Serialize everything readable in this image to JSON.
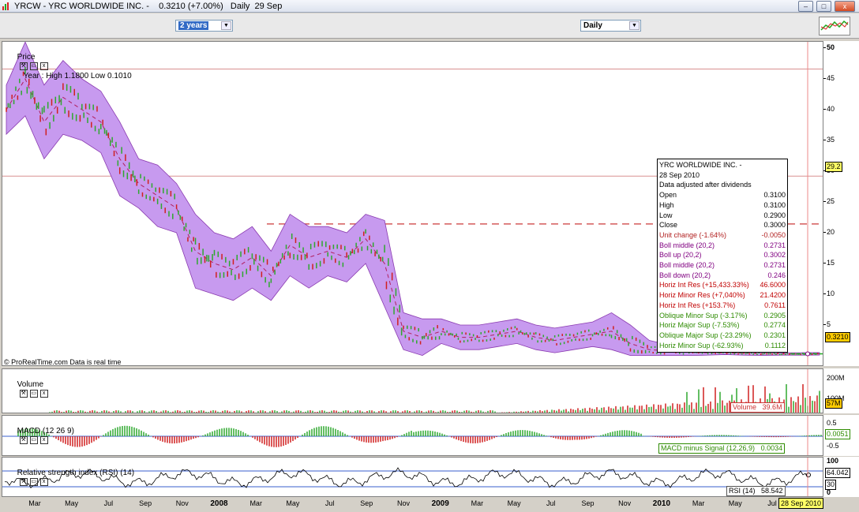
{
  "window": {
    "title": "YRCW - YRC WORLDWIDE INC. -    0.3210 (+7.00%)   Daily  29 Sep",
    "minimize": "–",
    "maximize": "□",
    "close": "x"
  },
  "toolbar": {
    "period": "2 years",
    "interval": "Daily"
  },
  "price_panel": {
    "title": "Price",
    "summary": "Year : High 1.1800 Low 0.1010",
    "footer": "© ProRealTime.com  Data is real time",
    "last_tag": "0.3210",
    "cursor_tag": "29.2"
  },
  "infobox": {
    "header": [
      "YRC WORLDWIDE INC. -",
      "28 Sep 2010",
      "Data adjusted after dividends"
    ],
    "rows": [
      {
        "label": "Open",
        "value": "0.3100",
        "color": "#000000"
      },
      {
        "label": "High",
        "value": "0.3100",
        "color": "#000000"
      },
      {
        "label": "Low",
        "value": "0.2900",
        "color": "#000000"
      },
      {
        "label": "Close",
        "value": "0.3000",
        "color": "#000000"
      },
      {
        "label": "Unit change (-1.64%)",
        "value": "-0.0050",
        "color": "#b22222"
      },
      {
        "label": "Boll middle (20,2)",
        "value": "0.2731",
        "color": "#800080"
      },
      {
        "label": "Boll up (20,2)",
        "value": "0.3002",
        "color": "#800080"
      },
      {
        "label": "Boll middle (20,2)",
        "value": "0.2731",
        "color": "#800080"
      },
      {
        "label": "Boll down (20,2)",
        "value": "0.246",
        "color": "#800080"
      },
      {
        "label": "Horiz Int Res (+15,433.33%)",
        "value": "46.6000",
        "color": "#c00000"
      },
      {
        "label": "Horiz Minor Res (+7,040%)",
        "value": "21.4200",
        "color": "#c00000"
      },
      {
        "label": "Horiz Int Res (+153.7%)",
        "value": "0.7611",
        "color": "#c00000"
      },
      {
        "label": "Oblique Minor Sup (-3.17%)",
        "value": "0.2905",
        "color": "#2e8b00"
      },
      {
        "label": "Horiz Major Sup (-7.53%)",
        "value": "0.2774",
        "color": "#2e8b00"
      },
      {
        "label": "Oblique Major Sup (-23.29%)",
        "value": "0.2301",
        "color": "#2e8b00"
      },
      {
        "label": "Horiz Minor Sup (-62.93%)",
        "value": "0.1112",
        "color": "#2e8b00"
      }
    ]
  },
  "volume_panel": {
    "title": "Volume",
    "readout_label": "Volume",
    "readout_value": "39.6M",
    "last_tag": "57M"
  },
  "macd_panel": {
    "title": "MACD (12 26 9)",
    "readout": "MACD minus Signal (12,26,9)",
    "readout_value": "0.0034",
    "last_tag": "0.0051"
  },
  "rsi_panel": {
    "title": "Relative strength index (RSI) (14)",
    "readout": "RSI (14)",
    "readout_value": "58.542",
    "last_tag": "64.042",
    "level_tag": "30"
  },
  "x_axis": {
    "labels": [
      {
        "t": "Mar",
        "yr": false
      },
      {
        "t": "May",
        "yr": false
      },
      {
        "t": "Jul",
        "yr": false
      },
      {
        "t": "Sep",
        "yr": false
      },
      {
        "t": "Nov",
        "yr": false
      },
      {
        "t": "2008",
        "yr": true
      },
      {
        "t": "Mar",
        "yr": false
      },
      {
        "t": "May",
        "yr": false
      },
      {
        "t": "Jul",
        "yr": false
      },
      {
        "t": "Sep",
        "yr": false
      },
      {
        "t": "Nov",
        "yr": false
      },
      {
        "t": "2009",
        "yr": true
      },
      {
        "t": "Mar",
        "yr": false
      },
      {
        "t": "May",
        "yr": false
      },
      {
        "t": "Jul",
        "yr": false
      },
      {
        "t": "Sep",
        "yr": false
      },
      {
        "t": "Nov",
        "yr": false
      },
      {
        "t": "2010",
        "yr": true
      },
      {
        "t": "Mar",
        "yr": false
      },
      {
        "t": "May",
        "yr": false
      },
      {
        "t": "Jul",
        "yr": false
      }
    ],
    "cursor": "28 Sep 2010"
  },
  "chart_data": {
    "type": "line",
    "title": "Price",
    "x": [
      "2007-02",
      "2007-03",
      "2007-04",
      "2007-05",
      "2007-06",
      "2007-07",
      "2007-08",
      "2007-09",
      "2007-10",
      "2007-11",
      "2007-12",
      "2008-01",
      "2008-02",
      "2008-03",
      "2008-04",
      "2008-05",
      "2008-06",
      "2008-07",
      "2008-08",
      "2008-09",
      "2008-10",
      "2008-11",
      "2008-12",
      "2009-01",
      "2009-02",
      "2009-03",
      "2009-04",
      "2009-05",
      "2009-06",
      "2009-07",
      "2009-08",
      "2009-09",
      "2009-10",
      "2009-11",
      "2009-12",
      "2010-01",
      "2010-02",
      "2010-03",
      "2010-04",
      "2010-05",
      "2010-06",
      "2010-07",
      "2010-08",
      "2010-09"
    ],
    "series": [
      {
        "name": "Price",
        "values": [
          40,
          45,
          38,
          42,
          40,
          38,
          32,
          28,
          26,
          24,
          17,
          15,
          14,
          16,
          13,
          18,
          16,
          17,
          16,
          19,
          15,
          4,
          3,
          4,
          3,
          3,
          3.5,
          4,
          3,
          2.5,
          3,
          3.5,
          4,
          2,
          1,
          0.8,
          0.6,
          0.5,
          0.5,
          0.4,
          0.35,
          0.3,
          0.3,
          0.32
        ]
      }
    ],
    "boll_width": [
      4,
      6,
      6,
      6,
      5,
      5,
      6,
      4,
      5,
      4,
      6,
      5,
      5,
      5,
      4,
      5,
      5,
      4,
      4,
      4,
      7,
      3,
      3,
      2,
      2,
      2,
      2,
      2,
      2,
      2,
      2,
      2,
      3,
      3,
      1.5,
      1,
      0.6,
      0.4,
      0.3,
      0.3,
      0.3,
      0.2,
      0.2,
      0.2
    ],
    "ylim": [
      0,
      50
    ],
    "y_ticks": [
      5,
      10,
      15,
      20,
      25,
      30,
      35,
      40,
      45,
      50
    ],
    "horizontal_lines": [
      46.6,
      29.2
    ],
    "dashed_resistance": 21.42,
    "volume_ticks": [
      "200M",
      "100M"
    ],
    "macd_ticks": [
      "0.5",
      "-0.5"
    ],
    "rsi_ticks": [
      "100",
      "30",
      "0"
    ],
    "colors": {
      "band": "#c79aef",
      "band_edge": "#8a3ab0",
      "up": "#2fa82f",
      "down": "#d02020",
      "res": "#d45a5a"
    }
  }
}
